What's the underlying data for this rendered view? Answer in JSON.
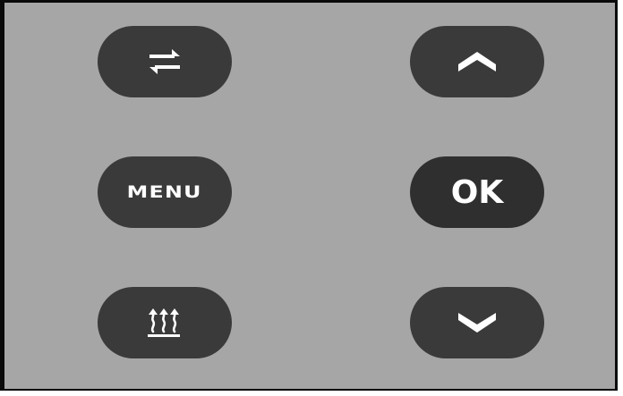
{
  "panel": {
    "background": "#a6a6a6",
    "button_color": "#3a3a3a",
    "buttons": {
      "swap": {
        "icon": "swap-arrows-icon"
      },
      "up": {
        "icon": "chevron-up-icon"
      },
      "menu": {
        "label": "MENU"
      },
      "ok": {
        "label": "OK"
      },
      "heat": {
        "icon": "heating-icon"
      },
      "down": {
        "icon": "chevron-down-icon"
      }
    }
  }
}
